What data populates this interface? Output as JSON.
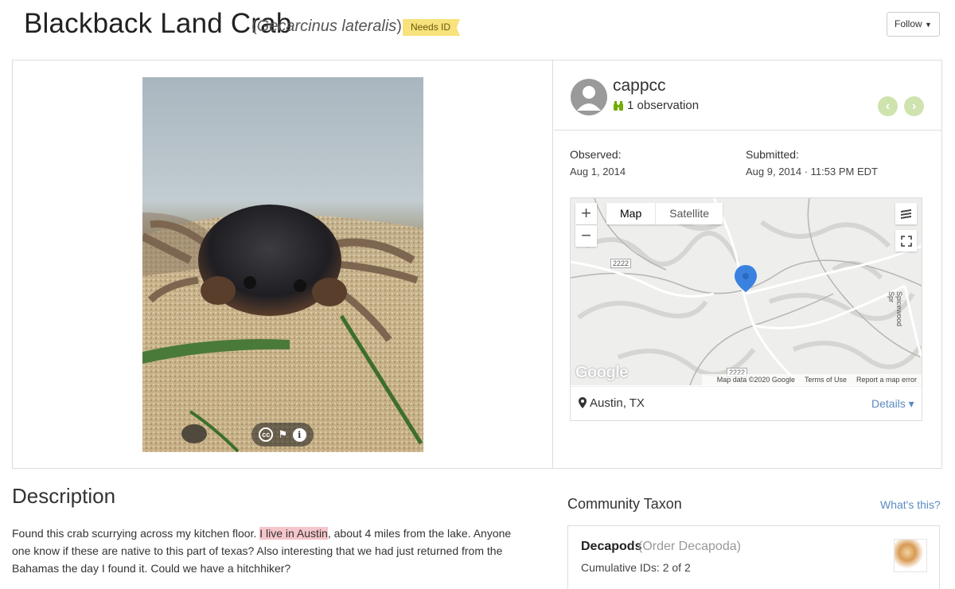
{
  "header": {
    "common_name": "Blackback Land Crab",
    "paren_open": "(",
    "scientific_name": "Gecarcinus lateralis",
    "paren_close": ")",
    "quality_badge": "Needs ID",
    "follow_label": "Follow"
  },
  "photo": {
    "alt": "Crab on sand in white container",
    "controls": [
      "cc-icon",
      "flag-icon",
      "info-icon"
    ],
    "cc_label": "cc",
    "flag_label": "⚑",
    "info_label": "i"
  },
  "user": {
    "name": "cappcc",
    "observations": "1 observation"
  },
  "nav": {
    "prev": "‹",
    "next": "›"
  },
  "dates": {
    "observed_label": "Observed:",
    "observed_value": "Aug 1, 2014",
    "submitted_label": "Submitted:",
    "submitted_value": "Aug 9, 2014 · 11:53 PM EDT"
  },
  "map": {
    "zoom_in": "+",
    "zoom_out": "−",
    "types": [
      "Map",
      "Satellite"
    ],
    "selected_type": "Map",
    "road_labels": [
      "2222",
      "2222",
      "Spicewood Spr"
    ],
    "logo": "Google",
    "footer": [
      "Map data ©2020 Google",
      "Terms of Use",
      "Report a map error"
    ],
    "place": "Austin, TX",
    "details_label": "Details ▾"
  },
  "description": {
    "title": "Description",
    "before": "Found this crab scurrying across my kitchen floor. ",
    "highlight": "I live in Austin",
    "after": ", about 4 miles from the lake. Anyone one know if these are native to this part of texas? Also interesting that we had just returned from the Bahamas the day I found it. Could we have a hitchhiker?"
  },
  "community_taxon": {
    "title": "Community Taxon",
    "whats_this": "What's this?",
    "name": "Decapods",
    "rank": "(Order Decapoda)",
    "cumulative": "Cumulative IDs: 2 of 2"
  },
  "colors": {
    "accent_green": "#74ac00",
    "needs_id_yellow": "#f7e27b",
    "link_blue": "#5a8bc2",
    "pin_blue": "#3b82e0"
  }
}
